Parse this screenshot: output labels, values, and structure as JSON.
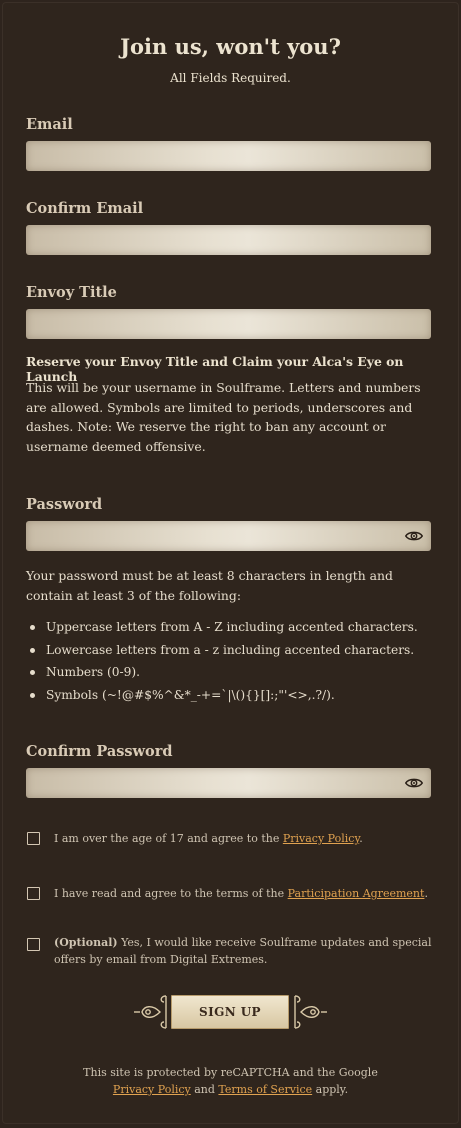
{
  "header": {
    "title": "Join us, won't you?",
    "subtitle": "All Fields Required."
  },
  "fields": {
    "email": {
      "label": "Email",
      "value": ""
    },
    "confirm_email": {
      "label": "Confirm Email",
      "value": ""
    },
    "envoy_title": {
      "label": "Envoy Title",
      "value": ""
    },
    "password": {
      "label": "Password",
      "value": ""
    },
    "confirm_password": {
      "label": "Confirm Password",
      "value": ""
    }
  },
  "envoy_info": {
    "heading": "Reserve your Envoy Title and Claim your Alca's Eye on Launch",
    "text": "This will be your username in Soulframe. Letters and numbers are allowed. Symbols are limited to periods, underscores and dashes. Note: We reserve the right to ban any account or username deemed offensive."
  },
  "password_rules": {
    "intro": "Your password must be at least 8 characters in length and contain at least 3 of the following:",
    "items": [
      "Uppercase letters from A - Z including accented characters.",
      "Lowercase letters from a - z including accented characters.",
      "Numbers (0-9).",
      "Symbols (~!@#$%^&*_-+=`|\\(){}[]:;\"'<>,.?/)."
    ]
  },
  "checkboxes": {
    "age": {
      "text": "I am over the age of 17 and agree to the ",
      "link": "Privacy Policy",
      "suffix": ".",
      "checked": false
    },
    "agreement": {
      "text": "I have read and agree to the terms of the ",
      "link": "Participation Agreement",
      "suffix": ".",
      "checked": false
    },
    "optional": {
      "prefix": "(Optional)",
      "text": " Yes, I would like receive Soulframe updates and special offers by email from Digital Extremes.",
      "checked": false
    }
  },
  "actions": {
    "signup_label": "SIGN UP"
  },
  "footer": {
    "line1": "This site is protected by reCAPTCHA and the Google",
    "privacy_link": "Privacy Policy",
    "and": " and ",
    "terms_link": "Terms of Service",
    "apply": " apply."
  },
  "icons": {
    "password_toggle": "eye-icon",
    "ornament": "flourish-icon"
  },
  "colors": {
    "background": "#2f251d",
    "link": "#e0a250",
    "button": "#e8dcc0"
  }
}
